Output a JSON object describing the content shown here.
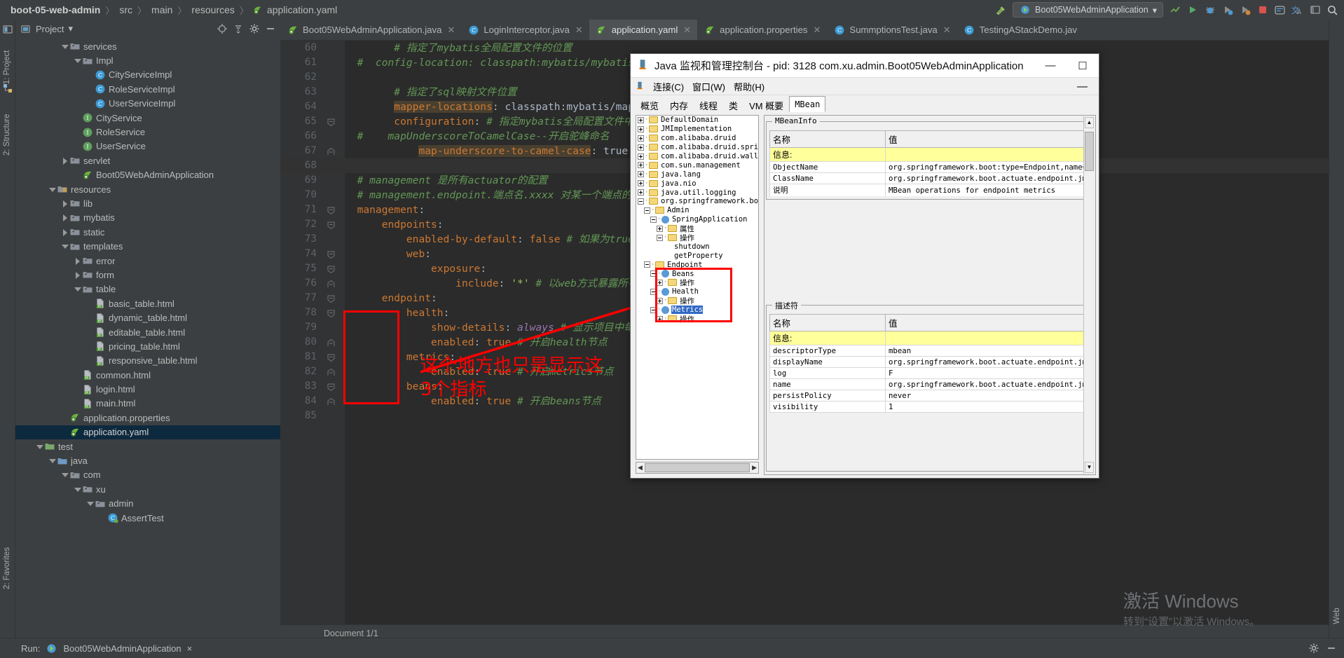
{
  "breadcrumb": {
    "items": [
      "boot-05-web-admin",
      "src",
      "main",
      "resources",
      "application.yaml"
    ],
    "separator": "〉"
  },
  "toolbar": {
    "run_config_label": "Boot05WebAdminApplication",
    "icons": [
      "build-hammer-icon",
      "spring-icon",
      "chevron-down-icon",
      "run-icon",
      "debug-icon",
      "coverage-icon",
      "profiler-icon",
      "stop-icon",
      "search-everywhere-icon",
      "translate-icon",
      "layout-icon",
      "search-icon"
    ]
  },
  "left_strips": {
    "top": [
      "1: Project",
      "2: Structure"
    ],
    "bottom": [
      "2: Favorites"
    ],
    "right": [
      "Web"
    ]
  },
  "project_panel": {
    "title": "Project",
    "header_icons": [
      "locate-icon",
      "collapse-all-icon",
      "gear-icon",
      "minimize-icon"
    ],
    "tree": [
      {
        "depth": 3,
        "arrow": "down",
        "icon": "folder",
        "label": "services"
      },
      {
        "depth": 4,
        "arrow": "down",
        "icon": "folder",
        "label": "Impl"
      },
      {
        "depth": 5,
        "arrow": "none",
        "icon": "class",
        "label": "CityServiceImpl"
      },
      {
        "depth": 5,
        "arrow": "none",
        "icon": "class",
        "label": "RoleServiceImpl"
      },
      {
        "depth": 5,
        "arrow": "none",
        "icon": "class",
        "label": "UserServiceImpl"
      },
      {
        "depth": 4,
        "arrow": "none",
        "icon": "interface",
        "label": "CityService"
      },
      {
        "depth": 4,
        "arrow": "none",
        "icon": "interface",
        "label": "RoleService"
      },
      {
        "depth": 4,
        "arrow": "none",
        "icon": "interface",
        "label": "UserService"
      },
      {
        "depth": 3,
        "arrow": "right",
        "icon": "folder",
        "label": "servlet"
      },
      {
        "depth": 4,
        "arrow": "none",
        "icon": "spring",
        "label": "Boot05WebAdminApplication"
      },
      {
        "depth": 2,
        "arrow": "down",
        "icon": "resources",
        "label": "resources"
      },
      {
        "depth": 3,
        "arrow": "right",
        "icon": "folder",
        "label": "lib"
      },
      {
        "depth": 3,
        "arrow": "right",
        "icon": "folder",
        "label": "mybatis"
      },
      {
        "depth": 3,
        "arrow": "right",
        "icon": "folder",
        "label": "static"
      },
      {
        "depth": 3,
        "arrow": "down",
        "icon": "folder",
        "label": "templates"
      },
      {
        "depth": 4,
        "arrow": "right",
        "icon": "folder",
        "label": "error"
      },
      {
        "depth": 4,
        "arrow": "right",
        "icon": "folder",
        "label": "form"
      },
      {
        "depth": 4,
        "arrow": "down",
        "icon": "folder",
        "label": "table"
      },
      {
        "depth": 5,
        "arrow": "none",
        "icon": "html",
        "label": "basic_table.html"
      },
      {
        "depth": 5,
        "arrow": "none",
        "icon": "html",
        "label": "dynamic_table.html"
      },
      {
        "depth": 5,
        "arrow": "none",
        "icon": "html",
        "label": "editable_table.html"
      },
      {
        "depth": 5,
        "arrow": "none",
        "icon": "html",
        "label": "pricing_table.html"
      },
      {
        "depth": 5,
        "arrow": "none",
        "icon": "html",
        "label": "responsive_table.html"
      },
      {
        "depth": 4,
        "arrow": "none",
        "icon": "html",
        "label": "common.html"
      },
      {
        "depth": 4,
        "arrow": "none",
        "icon": "html",
        "label": "login.html"
      },
      {
        "depth": 4,
        "arrow": "none",
        "icon": "html",
        "label": "main.html"
      },
      {
        "depth": 3,
        "arrow": "none",
        "icon": "spring",
        "label": "application.properties"
      },
      {
        "depth": 3,
        "arrow": "none",
        "icon": "spring",
        "label": "application.yaml",
        "selected": true
      },
      {
        "depth": 1,
        "arrow": "down",
        "icon": "folder-test",
        "label": "test"
      },
      {
        "depth": 2,
        "arrow": "down",
        "icon": "folder-src",
        "label": "java"
      },
      {
        "depth": 3,
        "arrow": "down",
        "icon": "folder",
        "label": "com"
      },
      {
        "depth": 4,
        "arrow": "down",
        "icon": "folder",
        "label": "xu"
      },
      {
        "depth": 5,
        "arrow": "down",
        "icon": "folder",
        "label": "admin"
      },
      {
        "depth": 6,
        "arrow": "none",
        "icon": "class-test",
        "label": "AssertTest"
      }
    ]
  },
  "editor": {
    "tabs": [
      {
        "label": "Boot05WebAdminApplication.java",
        "icon": "spring-class-icon",
        "active": false,
        "closable": true
      },
      {
        "label": "LoginInterceptor.java",
        "icon": "java-class-icon",
        "active": false,
        "closable": true
      },
      {
        "label": "application.yaml",
        "icon": "spring-yaml-icon",
        "active": true,
        "closable": true
      },
      {
        "label": "application.properties",
        "icon": "spring-yaml-icon",
        "active": false,
        "closable": true
      },
      {
        "label": "SummptionsTest.java",
        "icon": "java-class-icon",
        "active": false,
        "closable": true
      },
      {
        "label": "TestingAStackDemo.jav",
        "icon": "java-class-icon",
        "active": false,
        "closable": false
      }
    ],
    "status": "Document 1/1",
    "lines": [
      {
        "n": 60,
        "fold": "",
        "indent": 4,
        "segments": [
          {
            "t": "# 指定了mybatis全局配置文件的位置",
            "c": "c-comment"
          }
        ]
      },
      {
        "n": 61,
        "fold": "",
        "indent": 1,
        "segments": [
          {
            "t": "#  config-location: classpath:mybatis/mybatis-config.",
            "c": "c-comment"
          }
        ]
      },
      {
        "n": 62,
        "fold": "",
        "indent": 0,
        "segments": []
      },
      {
        "n": 63,
        "fold": "",
        "indent": 4,
        "segments": [
          {
            "t": "# 指定了sql映射文件位置",
            "c": "c-comment"
          }
        ]
      },
      {
        "n": 64,
        "fold": "",
        "indent": 4,
        "segments": [
          {
            "t": "mapper-locations",
            "c": "hl-key"
          },
          {
            "t": ": ",
            "c": "c-plain"
          },
          {
            "t": "classpath:mybatis/mapper/*.xml",
            "c": "c-plain"
          }
        ]
      },
      {
        "n": 65,
        "fold": "minus",
        "indent": 4,
        "segments": [
          {
            "t": "configuration",
            "c": "c-key"
          },
          {
            "t": ": ",
            "c": "c-plain"
          },
          {
            "t": "# 指定mybatis全局配置文件中的相关配置",
            "c": "c-comment"
          }
        ]
      },
      {
        "n": 66,
        "fold": "",
        "indent": 1,
        "segments": [
          {
            "t": "#    mapUnderscoreToCamelCase--开启驼峰命名",
            "c": "c-comment"
          }
        ]
      },
      {
        "n": 67,
        "fold": "end",
        "indent": 6,
        "segments": [
          {
            "t": "map-underscore-to-camel-case",
            "c": "hl-key"
          },
          {
            "t": ": ",
            "c": "c-plain"
          },
          {
            "t": "true",
            "c": "c-plain"
          }
        ]
      },
      {
        "n": 68,
        "fold": "",
        "indent": 0,
        "segments": [],
        "current": true
      },
      {
        "n": 69,
        "fold": "",
        "indent": 1,
        "segments": [
          {
            "t": "# management 是所有actuator的配置",
            "c": "c-comment"
          }
        ]
      },
      {
        "n": 70,
        "fold": "",
        "indent": 1,
        "segments": [
          {
            "t": "# management.endpoint.端点名.xxxx 对某一个端点的具体配置",
            "c": "c-comment"
          }
        ]
      },
      {
        "n": 71,
        "fold": "minus",
        "indent": 1,
        "segments": [
          {
            "t": "management",
            "c": "c-key"
          },
          {
            "t": ":",
            "c": "c-plain"
          }
        ]
      },
      {
        "n": 72,
        "fold": "minus",
        "indent": 3,
        "segments": [
          {
            "t": "endpoints",
            "c": "c-key"
          },
          {
            "t": ":",
            "c": "c-plain"
          }
        ]
      },
      {
        "n": 73,
        "fold": "",
        "indent": 5,
        "segments": [
          {
            "t": "enabled-by-default",
            "c": "c-key"
          },
          {
            "t": ": ",
            "c": "c-plain"
          },
          {
            "t": "false",
            "c": "c-key"
          },
          {
            "t": " # 如果为true,默认开启所有的",
            "c": "c-comment"
          }
        ]
      },
      {
        "n": 74,
        "fold": "minus",
        "indent": 5,
        "segments": [
          {
            "t": "web",
            "c": "c-key"
          },
          {
            "t": ":",
            "c": "c-plain"
          }
        ]
      },
      {
        "n": 75,
        "fold": "minus",
        "indent": 7,
        "segments": [
          {
            "t": "exposure",
            "c": "c-key"
          },
          {
            "t": ":",
            "c": "c-plain"
          }
        ]
      },
      {
        "n": 76,
        "fold": "end",
        "indent": 9,
        "segments": [
          {
            "t": "include",
            "c": "c-key"
          },
          {
            "t": ": ",
            "c": "c-plain"
          },
          {
            "t": "'*'",
            "c": "c-str"
          },
          {
            "t": " # 以web方式暴露所有的端点",
            "c": "c-comment"
          }
        ]
      },
      {
        "n": 77,
        "fold": "minus",
        "indent": 3,
        "segments": [
          {
            "t": "endpoint",
            "c": "c-key"
          },
          {
            "t": ":",
            "c": "c-plain"
          }
        ]
      },
      {
        "n": 78,
        "fold": "minus",
        "indent": 5,
        "segments": [
          {
            "t": "health",
            "c": "c-key"
          },
          {
            "t": ":",
            "c": "c-plain"
          }
        ]
      },
      {
        "n": 79,
        "fold": "",
        "indent": 7,
        "segments": [
          {
            "t": "show-details",
            "c": "c-key"
          },
          {
            "t": ": ",
            "c": "c-plain"
          },
          {
            "t": "always",
            "c": "c-purple"
          },
          {
            "t": " # 显示项目中每个部分健康状态",
            "c": "c-comment"
          }
        ]
      },
      {
        "n": 80,
        "fold": "end",
        "indent": 7,
        "segments": [
          {
            "t": "enabled",
            "c": "c-key"
          },
          {
            "t": ": ",
            "c": "c-plain"
          },
          {
            "t": "true",
            "c": "c-key"
          },
          {
            "t": " # 开启health节点",
            "c": "c-comment"
          }
        ]
      },
      {
        "n": 81,
        "fold": "minus",
        "indent": 5,
        "segments": [
          {
            "t": "metrics",
            "c": "c-key"
          },
          {
            "t": ":",
            "c": "c-plain"
          }
        ]
      },
      {
        "n": 82,
        "fold": "end",
        "indent": 7,
        "segments": [
          {
            "t": "enabled",
            "c": "c-key"
          },
          {
            "t": ": ",
            "c": "c-plain"
          },
          {
            "t": "true",
            "c": "c-key"
          },
          {
            "t": " # 开启metrics节点",
            "c": "c-comment"
          }
        ]
      },
      {
        "n": 83,
        "fold": "minus",
        "indent": 5,
        "segments": [
          {
            "t": "beans",
            "c": "c-key"
          },
          {
            "t": ":",
            "c": "c-plain"
          }
        ]
      },
      {
        "n": 84,
        "fold": "end",
        "indent": 7,
        "segments": [
          {
            "t": "enabled",
            "c": "c-key"
          },
          {
            "t": ": ",
            "c": "c-plain"
          },
          {
            "t": "true",
            "c": "c-key"
          },
          {
            "t": " # 开启beans节点",
            "c": "c-comment"
          }
        ]
      },
      {
        "n": 85,
        "fold": "",
        "indent": 0,
        "segments": []
      }
    ]
  },
  "annotations": {
    "note_line1": "这个地方也只是显示这",
    "note_line2": "3个指标",
    "color": "#ff0000"
  },
  "jconsole": {
    "title": "Java 监视和管理控制台 - pid: 3128 com.xu.admin.Boot05WebAdminApplication",
    "window_buttons": {
      "minimize": "—",
      "maximize": "☐"
    },
    "menus": [
      "连接(C)",
      "窗口(W)",
      "帮助(H)"
    ],
    "inner_minimize": "—",
    "tabs": [
      "概览",
      "内存",
      "线程",
      "类",
      "VM 概要",
      "MBean"
    ],
    "active_tab": "MBean",
    "tree": [
      {
        "indent": 0,
        "expander": "plus",
        "icon": "folder",
        "label": "DefaultDomain"
      },
      {
        "indent": 0,
        "expander": "plus",
        "icon": "folder",
        "label": "JMImplementation"
      },
      {
        "indent": 0,
        "expander": "plus",
        "icon": "folder",
        "label": "com.alibaba.druid"
      },
      {
        "indent": 0,
        "expander": "plus",
        "icon": "folder",
        "label": "com.alibaba.druid.spring.boot."
      },
      {
        "indent": 0,
        "expander": "plus",
        "icon": "folder",
        "label": "com.alibaba.druid.wall"
      },
      {
        "indent": 0,
        "expander": "plus",
        "icon": "folder",
        "label": "com.sun.management"
      },
      {
        "indent": 0,
        "expander": "plus",
        "icon": "folder",
        "label": "java.lang"
      },
      {
        "indent": 0,
        "expander": "plus",
        "icon": "folder",
        "label": "java.nio"
      },
      {
        "indent": 0,
        "expander": "plus",
        "icon": "folder",
        "label": "java.util.logging"
      },
      {
        "indent": 0,
        "expander": "minus",
        "icon": "folder",
        "label": "org.springframework.boot"
      },
      {
        "indent": 1,
        "expander": "minus",
        "icon": "folder",
        "label": "Admin"
      },
      {
        "indent": 2,
        "expander": "minus",
        "icon": "mbean",
        "label": "SpringApplication"
      },
      {
        "indent": 3,
        "expander": "plus",
        "icon": "folder",
        "label": "属性"
      },
      {
        "indent": 3,
        "expander": "minus",
        "icon": "folder",
        "label": "操作"
      },
      {
        "indent": 4,
        "expander": "none",
        "icon": "none",
        "label": "shutdown"
      },
      {
        "indent": 4,
        "expander": "none",
        "icon": "none",
        "label": "getProperty"
      },
      {
        "indent": 1,
        "expander": "minus",
        "icon": "folder",
        "label": "Endpoint"
      },
      {
        "indent": 2,
        "expander": "minus",
        "icon": "mbean",
        "label": "Beans"
      },
      {
        "indent": 3,
        "expander": "plus",
        "icon": "folder",
        "label": "操作"
      },
      {
        "indent": 2,
        "expander": "minus",
        "icon": "mbean",
        "label": "Health"
      },
      {
        "indent": 3,
        "expander": "plus",
        "icon": "folder",
        "label": "操作"
      },
      {
        "indent": 2,
        "expander": "minus",
        "icon": "mbean",
        "label": "Metrics",
        "selected": true
      },
      {
        "indent": 3,
        "expander": "plus",
        "icon": "folder",
        "label": "操作"
      }
    ],
    "mbeaninfo": {
      "group_label": "MBeanInfo",
      "columns": [
        "名称",
        "值"
      ],
      "rows": [
        {
          "name": "信息:",
          "value": "",
          "highlight": true
        },
        {
          "name": "ObjectName",
          "value": "org.springframework.boot:type=Endpoint,name=Metrics"
        },
        {
          "name": "ClassName",
          "value": "org.springframework.boot.actuate.endpoint.jmx.EndpointMBean"
        },
        {
          "name": "说明",
          "value": "MBean operations for endpoint metrics"
        }
      ]
    },
    "descriptor": {
      "group_label": "描述符",
      "columns": [
        "名称",
        "值"
      ],
      "rows": [
        {
          "name": "信息:",
          "value": "",
          "highlight": true
        },
        {
          "name": "descriptorType",
          "value": "mbean"
        },
        {
          "name": "displayName",
          "value": "org.springframework.boot.actuate.endpoint.jmx.EndpointMBean"
        },
        {
          "name": "log",
          "value": "F"
        },
        {
          "name": "name",
          "value": "org.springframework.boot.actuate.endpoint.jmx.EndpointMBean"
        },
        {
          "name": "persistPolicy",
          "value": "never"
        },
        {
          "name": "visibility",
          "value": "1"
        }
      ]
    }
  },
  "bottom": {
    "run_label": "Run:",
    "run_config": "Boot05WebAdminApplication",
    "close_mark": "×",
    "icons": [
      "gear-icon",
      "minimize-icon"
    ]
  },
  "watermark": {
    "line1": "激活 Windows",
    "line2": "转到“设置”以激活 Windows。"
  }
}
